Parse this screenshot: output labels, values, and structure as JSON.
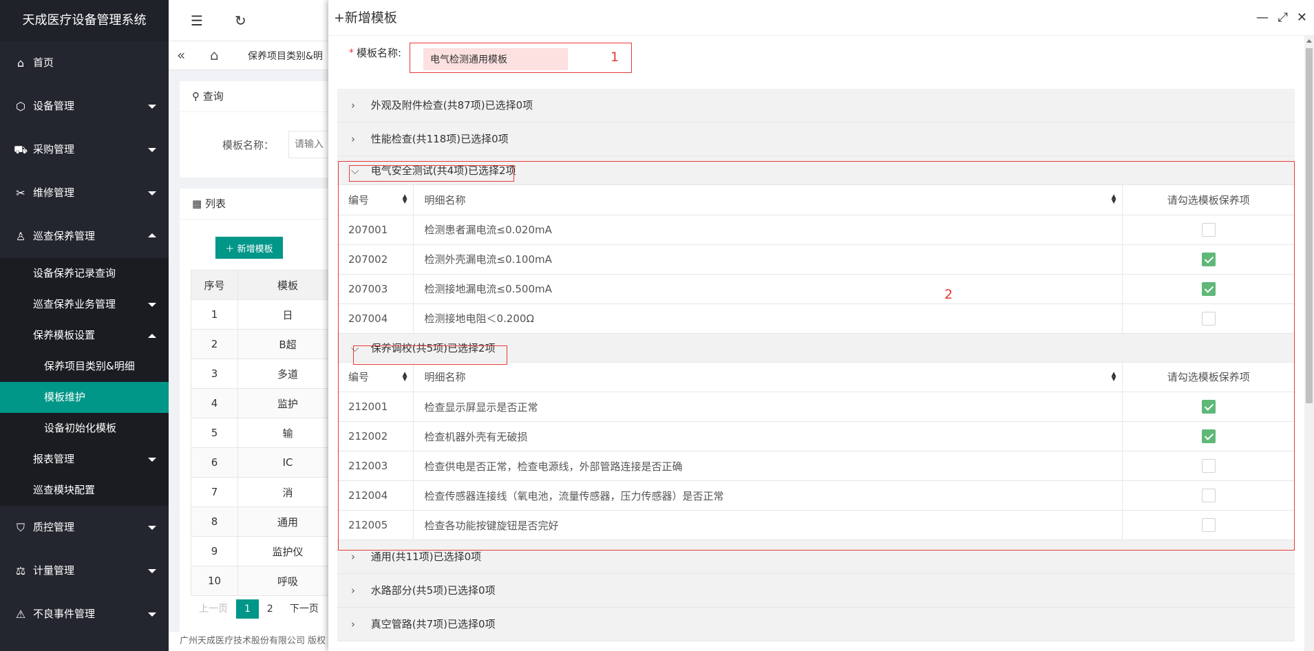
{
  "app": {
    "title": "天成医疗设备管理系统"
  },
  "sidebar": {
    "items": [
      {
        "label": "首页",
        "icon": "home-icon"
      },
      {
        "label": "设备管理",
        "icon": "cube-icon"
      },
      {
        "label": "采购管理",
        "icon": "cart-icon"
      },
      {
        "label": "维修管理",
        "icon": "tools-icon"
      },
      {
        "label": "巡查保养管理",
        "icon": "person-icon"
      },
      {
        "label": "质控管理",
        "icon": "shield-check-icon"
      },
      {
        "label": "计量管理",
        "icon": "scale-icon"
      },
      {
        "label": "不良事件管理",
        "icon": "warning-icon"
      }
    ],
    "sub": {
      "record_query": "设备保养记录查询",
      "business": "巡查保养业务管理",
      "template_settings": "保养模板设置",
      "category_detail": "保养项目类别&明细",
      "template_maint": "模板维护",
      "device_init": "设备初始化模板",
      "report": "报表管理",
      "module_config": "巡查模块配置"
    }
  },
  "tabs": {
    "current": "保养项目类别&明"
  },
  "background": {
    "query_title": "查询",
    "query_label": "模板名称：",
    "query_placeholder": "请输入",
    "list_title": "列表",
    "add_button": "新增模板",
    "table_headers": [
      "序号",
      "模板"
    ],
    "rows": [
      {
        "no": "1",
        "name": "日"
      },
      {
        "no": "2",
        "name": "B超"
      },
      {
        "no": "3",
        "name": "多道"
      },
      {
        "no": "4",
        "name": "监护"
      },
      {
        "no": "5",
        "name": "输"
      },
      {
        "no": "6",
        "name": "IC"
      },
      {
        "no": "7",
        "name": "消"
      },
      {
        "no": "8",
        "name": "通用"
      },
      {
        "no": "9",
        "name": "监护仪"
      },
      {
        "no": "10",
        "name": "呼吸"
      }
    ],
    "pager": {
      "prev": "上一页",
      "p1": "1",
      "p2": "2",
      "next": "下一页"
    },
    "footer": "广州天成医疗技术股份有限公司 版权"
  },
  "modal": {
    "title": "+新增模板",
    "name_required": "*",
    "name_label": "模板名称:",
    "name_value": "电气检测通用模板",
    "annotation_1": "1",
    "annotation_2": "2",
    "sections": {
      "s1": "外观及附件检查(共87项)已选择0项",
      "s2": "性能检查(共118项)已选择0项",
      "s3": "电气安全测试(共4项)已选择2项",
      "s4": "保养调校(共5项)已选择2项",
      "s5": "通用(共11项)已选择0项",
      "s6": "水路部分(共5项)已选择0项",
      "s7": "真空管路(共7项)已选择0项"
    },
    "table_headers": {
      "code": "编号",
      "name": "明细名称",
      "check": "请勾选模板保养项"
    },
    "electric_rows": [
      {
        "code": "207001",
        "name": "检测患者漏电流≤0.020mA",
        "checked": false
      },
      {
        "code": "207002",
        "name": "检测外壳漏电流≤0.100mA",
        "checked": true
      },
      {
        "code": "207003",
        "name": "检测接地漏电流≤0.500mA",
        "checked": true
      },
      {
        "code": "207004",
        "name": "检测接地电阻＜0.200Ω",
        "checked": false
      }
    ],
    "calib_rows": [
      {
        "code": "212001",
        "name": "检查显示屏显示是否正常",
        "checked": true
      },
      {
        "code": "212002",
        "name": "检查机器外壳有无破损",
        "checked": true
      },
      {
        "code": "212003",
        "name": "检查供电是否正常，检查电源线，外部管路连接是否正确",
        "checked": false
      },
      {
        "code": "212004",
        "name": "检查传感器连接线（氧电池，流量传感器，压力传感器）是否正常",
        "checked": false
      },
      {
        "code": "212005",
        "name": "检查各功能按键旋钮是否完好",
        "checked": false
      }
    ]
  },
  "colors": {
    "accent": "#009688",
    "sidebar": "#23262e",
    "check": "#5fb878",
    "annotation": "#e53935"
  }
}
